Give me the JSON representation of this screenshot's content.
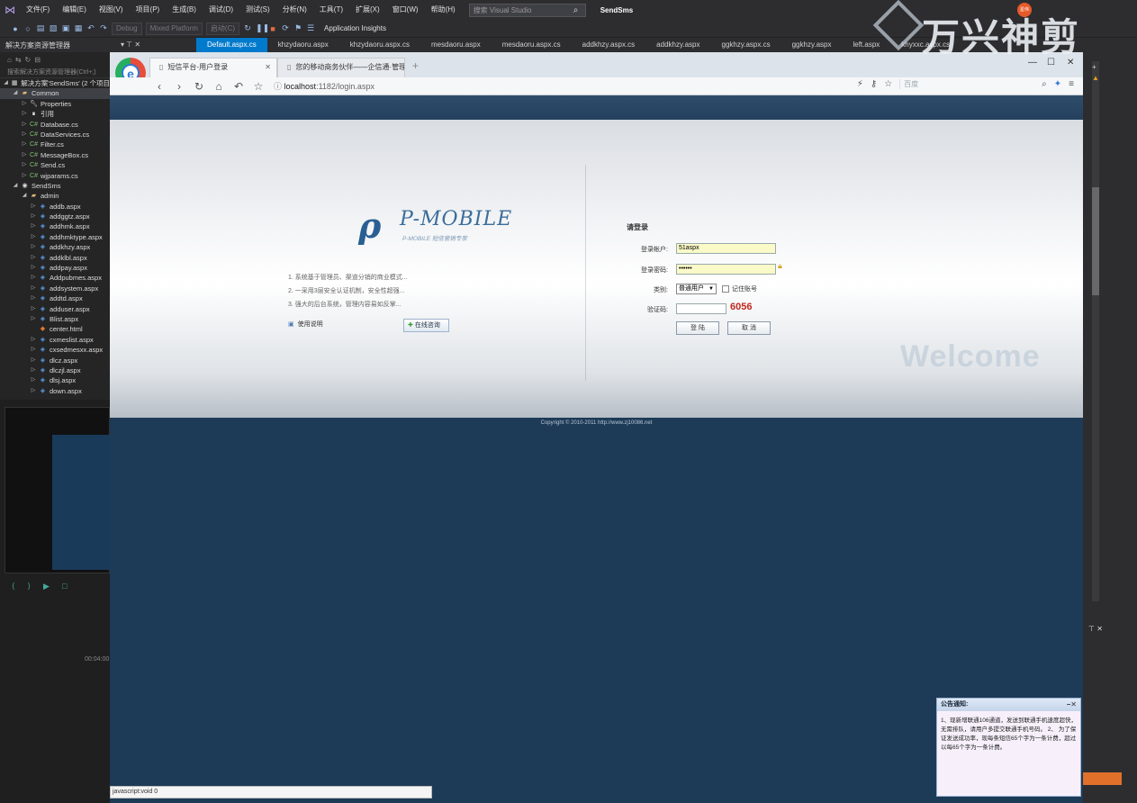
{
  "vs": {
    "menu": [
      "文件(F)",
      "编辑(E)",
      "视图(V)",
      "项目(P)",
      "生成(B)",
      "调试(D)",
      "测试(S)",
      "分析(N)",
      "工具(T)",
      "扩展(X)",
      "窗口(W)",
      "帮助(H)"
    ],
    "search_placeholder": "搜索 Visual Studio",
    "project": "SendSms",
    "toolbar": {
      "config": "Debug",
      "platform": "Mixed Platform",
      "start": "启动(C)",
      "insights": "Application Insights"
    },
    "solution_explorer_title": "解决方案资源管理器",
    "doc_tabs": [
      "Default.aspx.cs",
      "khzydaoru.aspx",
      "khzydaoru.aspx.cs",
      "mesdaoru.aspx",
      "mesdaoru.aspx.cs",
      "addkhzy.aspx.cs",
      "addkhzy.aspx",
      "ggkhzy.aspx.cs",
      "ggkhzy.aspx",
      "left.aspx",
      "khyxxc.aspx.cs"
    ],
    "se_search": "搜索解决方案资源管理器(Ctrl+;)",
    "tree": [
      {
        "label": "解决方案'SendSms' (2 个项目",
        "icon": "solution",
        "level": 0
      },
      {
        "label": "Common",
        "icon": "folder",
        "level": 1,
        "selected": true
      },
      {
        "label": "Properties",
        "icon": "wrench",
        "level": 2
      },
      {
        "label": "引用",
        "icon": "ref",
        "level": 2
      },
      {
        "label": "Database.cs",
        "icon": "cs",
        "level": 2
      },
      {
        "label": "DataServices.cs",
        "icon": "cs",
        "level": 2
      },
      {
        "label": "Filter.cs",
        "icon": "cs",
        "level": 2
      },
      {
        "label": "MessageBox.cs",
        "icon": "cs",
        "level": 2
      },
      {
        "label": "Send.cs",
        "icon": "cs",
        "level": 2
      },
      {
        "label": "wjparams.cs",
        "icon": "cs",
        "level": 2
      },
      {
        "label": "SendSms",
        "icon": "globe",
        "level": 1
      },
      {
        "label": "admin",
        "icon": "folder",
        "level": 2
      },
      {
        "label": "addb.aspx",
        "icon": "aspx",
        "level": 3
      },
      {
        "label": "addggtz.aspx",
        "icon": "aspx",
        "level": 3
      },
      {
        "label": "addhmk.aspx",
        "icon": "aspx",
        "level": 3
      },
      {
        "label": "addhmktype.aspx",
        "icon": "aspx",
        "level": 3
      },
      {
        "label": "addkhzy.aspx",
        "icon": "aspx",
        "level": 3
      },
      {
        "label": "addklbl.aspx",
        "icon": "aspx",
        "level": 3
      },
      {
        "label": "addpay.aspx",
        "icon": "aspx",
        "level": 3
      },
      {
        "label": "Addpubmes.aspx",
        "icon": "aspx",
        "level": 3
      },
      {
        "label": "addsystem.aspx",
        "icon": "aspx",
        "level": 3
      },
      {
        "label": "addtd.aspx",
        "icon": "aspx",
        "level": 3
      },
      {
        "label": "adduser.aspx",
        "icon": "aspx",
        "level": 3
      },
      {
        "label": "Blist.aspx",
        "icon": "aspx",
        "level": 3
      },
      {
        "label": "center.html",
        "icon": "html",
        "level": 3
      },
      {
        "label": "cxmeslist.aspx",
        "icon": "aspx",
        "level": 3
      },
      {
        "label": "cxsedmesxx.aspx",
        "icon": "aspx",
        "level": 3
      },
      {
        "label": "dlcz.aspx",
        "icon": "aspx",
        "level": 3
      },
      {
        "label": "dlczjl.aspx",
        "icon": "aspx",
        "level": 3
      },
      {
        "label": "dlsj.aspx",
        "icon": "aspx",
        "level": 3
      },
      {
        "label": "down.aspx",
        "icon": "aspx",
        "level": 3
      }
    ],
    "timeline_time": "00:04:00"
  },
  "browser": {
    "tabs": [
      {
        "label": "短信平台-用户登录",
        "active": true
      },
      {
        "label": "您的移动商务伙伴——企信通·管理",
        "active": false
      }
    ],
    "url_host": "localhost",
    "url_path": ":1182/login.aspx",
    "search_placeholder": "百度",
    "status_url": "javascript:void 0"
  },
  "login": {
    "logo_text": "P-MOBILE",
    "logo_sub": "P-MOBILE 短信营销专家",
    "features": [
      "1. 系统基于管理员、渠道分销的商业模式...",
      "2. 一采用3层安全认证机制，安全性超强...",
      "3. 强大的后台系统，管理内容易如反掌..."
    ],
    "help_link": "使用说明",
    "consult_button": "在线咨询",
    "title": "请登录",
    "account_label": "登录帐户:",
    "account_value": "51aspx",
    "password_label": "登录密码:",
    "password_value": "••••••",
    "type_label": "类别:",
    "type_value": "普通用户",
    "remember_label": "记住账号",
    "captcha_label": "验证码:",
    "captcha_code": "6056",
    "login_button": "登 陆",
    "cancel_button": "取 消",
    "welcome": "Welcome",
    "copyright": "Copyright © 2010-2011 http://www.zj10086.net"
  },
  "notice": {
    "title": "公告通知:",
    "body": "1、现新增联通106通道，发送到联通手机速度超快，无需排队，请用户多提交联通手机号码。 2、 为了保证发送成功率，现每条短信65个字为一条计费，超过以每65个字为一条计费。"
  },
  "watermark": {
    "text": "万兴神剪"
  },
  "avatar": {
    "text": "星伟"
  }
}
